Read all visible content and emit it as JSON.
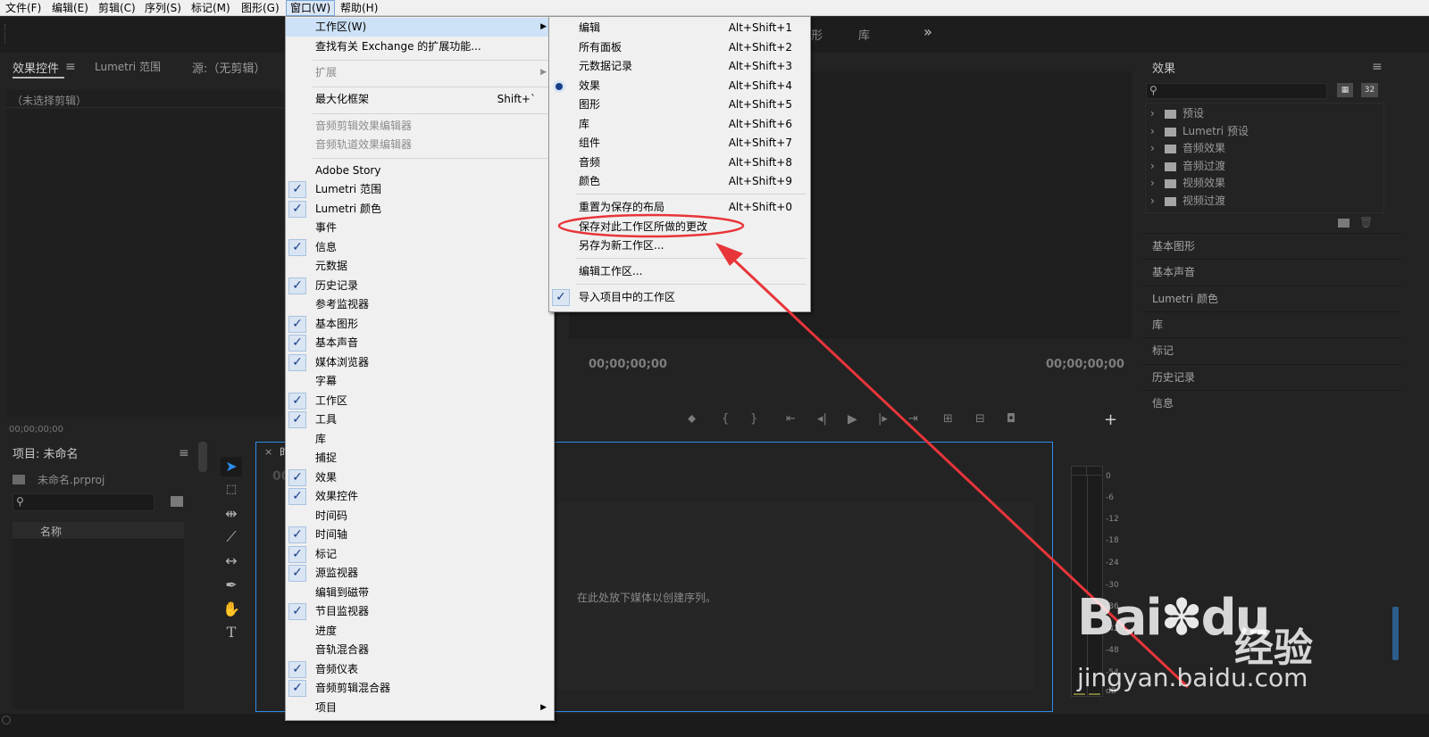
{
  "menubar": [
    "文件(F)",
    "编辑(E)",
    "剪辑(C)",
    "序列(S)",
    "标记(M)",
    "图形(G)",
    "窗口(W)",
    "帮助(H)"
  ],
  "workspace_tabs": {
    "partial": "形",
    "library": "库",
    "more": "»"
  },
  "effect_controls": {
    "tab1": "效果控件",
    "tab2": "Lumetri 范围",
    "tab3": "源:（无剪辑）",
    "empty": "（未选择剪辑）",
    "timecode": "00;00;00;00"
  },
  "project": {
    "title": "项目: 未命名",
    "file": "未命名.prproj",
    "column_name": "名称"
  },
  "program": {
    "timecode_left": "00;00;00;00",
    "timecode_right": "00;00;00;00"
  },
  "timeline": {
    "drop_hint": "在此处放下媒体以创建序列。",
    "tab_partial": "时",
    "timecode_partial": "00"
  },
  "audio_meter": {
    "ticks": [
      "0",
      "-6",
      "-12",
      "-18",
      "-24",
      "-30",
      "-36",
      "-42",
      "-48",
      "-54",
      "dB"
    ]
  },
  "effects_panel": {
    "title": "效果",
    "folders": [
      "预设",
      "Lumetri 预设",
      "音频效果",
      "音频过渡",
      "视频效果",
      "视频过渡"
    ]
  },
  "side_panels": [
    "基本图形",
    "基本声音",
    "Lumetri 颜色",
    "库",
    "标记",
    "历史记录",
    "信息"
  ],
  "window_menu": [
    {
      "label": "工作区(W)",
      "arrow": true,
      "hl": true
    },
    {
      "label": "查找有关 Exchange 的扩展功能..."
    },
    {
      "label": "扩展",
      "arrow": true,
      "dis": true,
      "sep": true
    },
    {
      "label": "最大化框架",
      "shortcut": "Shift+`",
      "sep": true
    },
    {
      "label": "音频剪辑效果编辑器",
      "dis": true,
      "sep": true
    },
    {
      "label": "音频轨道效果编辑器",
      "dis": true
    },
    {
      "label": "Adobe Story",
      "sep": true
    },
    {
      "label": "Lumetri 范围",
      "check": true
    },
    {
      "label": "Lumetri 颜色",
      "check": true
    },
    {
      "label": "事件"
    },
    {
      "label": "信息",
      "check": true
    },
    {
      "label": "元数据"
    },
    {
      "label": "历史记录",
      "check": true
    },
    {
      "label": "参考监视器"
    },
    {
      "label": "基本图形",
      "check": true
    },
    {
      "label": "基本声音",
      "check": true
    },
    {
      "label": "媒体浏览器",
      "check": true
    },
    {
      "label": "字幕"
    },
    {
      "label": "工作区",
      "check": true
    },
    {
      "label": "工具",
      "check": true
    },
    {
      "label": "库"
    },
    {
      "label": "捕捉"
    },
    {
      "label": "效果",
      "check": true
    },
    {
      "label": "效果控件",
      "check": true
    },
    {
      "label": "时间码"
    },
    {
      "label": "时间轴",
      "check": true
    },
    {
      "label": "标记",
      "check": true
    },
    {
      "label": "源监视器",
      "check": true
    },
    {
      "label": "编辑到磁带"
    },
    {
      "label": "节目监视器",
      "check": true
    },
    {
      "label": "进度"
    },
    {
      "label": "音轨混合器"
    },
    {
      "label": "音频仪表",
      "check": true
    },
    {
      "label": "音频剪辑混合器",
      "check": true
    },
    {
      "label": "项目",
      "arrow": true
    }
  ],
  "workspace_submenu": [
    {
      "label": "编辑",
      "shortcut": "Alt+Shift+1"
    },
    {
      "label": "所有面板",
      "shortcut": "Alt+Shift+2"
    },
    {
      "label": "元数据记录",
      "shortcut": "Alt+Shift+3"
    },
    {
      "label": "效果",
      "shortcut": "Alt+Shift+4",
      "radio": true
    },
    {
      "label": "图形",
      "shortcut": "Alt+Shift+5"
    },
    {
      "label": "库",
      "shortcut": "Alt+Shift+6"
    },
    {
      "label": "组件",
      "shortcut": "Alt+Shift+7"
    },
    {
      "label": "音频",
      "shortcut": "Alt+Shift+8"
    },
    {
      "label": "颜色",
      "shortcut": "Alt+Shift+9"
    },
    {
      "label": "重置为保存的布局",
      "shortcut": "Alt+Shift+0",
      "sep": true
    },
    {
      "label": "保存对此工作区所做的更改"
    },
    {
      "label": "另存为新工作区..."
    },
    {
      "label": "编辑工作区...",
      "sep": true
    },
    {
      "label": "导入项目中的工作区",
      "check": true,
      "sep": true
    }
  ],
  "watermark": {
    "brand": "Bai",
    "brand2": "du",
    "cn": "经验",
    "url": "jingyan.baidu.com"
  },
  "colors": {
    "annotation": "#e8353a",
    "menu_bg": "#f0f0f0",
    "panel_bg": "#232323",
    "accent": "#2d8ceb"
  }
}
